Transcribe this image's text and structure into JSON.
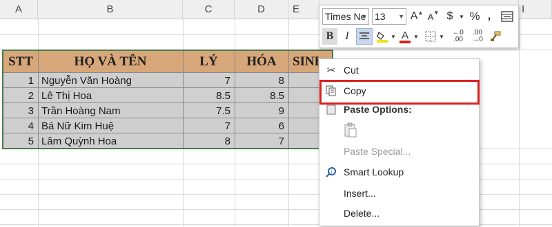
{
  "columns": [
    "A",
    "B",
    "C",
    "D",
    "E",
    "I"
  ],
  "table": {
    "headers": [
      "STT",
      "HỌ VÀ TÊN",
      "LÝ",
      "HÓA",
      "SINH"
    ],
    "rows": [
      {
        "stt": "1",
        "name": "Nguyễn Văn Hoàng",
        "ly": "7",
        "hoa": "8"
      },
      {
        "stt": "2",
        "name": "Lê Thị Hoa",
        "ly": "8.5",
        "hoa": "8.5"
      },
      {
        "stt": "3",
        "name": "Trần Hoàng Nam",
        "ly": "7.5",
        "hoa": "9"
      },
      {
        "stt": "4",
        "name": "Bá Nữ Kim Huệ",
        "ly": "7",
        "hoa": "6"
      },
      {
        "stt": "5",
        "name": "Lâm Quỳnh Hoa",
        "ly": "8",
        "hoa": "7"
      }
    ]
  },
  "mini_toolbar": {
    "font_name": "Times Ne",
    "font_size": "13",
    "increase_font": "A",
    "decrease_font": "A",
    "currency": "$",
    "percent": "%",
    "comma": ",",
    "bold": "B",
    "italic": "I",
    "font_color": "A",
    "decrease_decimal": ".00",
    "increase_decimal": ".00",
    "colors": {
      "fill": "#f5e21a",
      "font": "#d9201f"
    }
  },
  "context_menu": {
    "items": [
      {
        "label": "Cut",
        "icon": "scissors-icon"
      },
      {
        "label": "Copy",
        "icon": "copy-icon"
      },
      {
        "label": "Paste Options:",
        "icon": "paste-icon"
      },
      {
        "label": "Paste Special...",
        "icon": ""
      },
      {
        "label": "Smart Lookup",
        "icon": "smart-lookup-icon"
      },
      {
        "label": "Insert...",
        "icon": ""
      },
      {
        "label": "Delete...",
        "icon": ""
      }
    ],
    "highlight_color": "#d9201f"
  }
}
